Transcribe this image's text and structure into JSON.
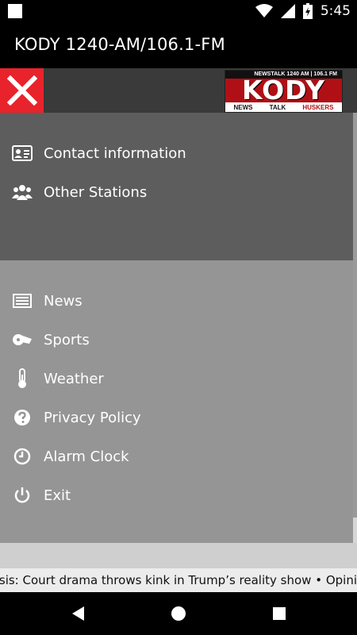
{
  "status_bar": {
    "time": "5:45"
  },
  "app_bar": {
    "title": "KODY 1240-AM/106.1-FM"
  },
  "logo": {
    "top": "NEWSTALK  1240 AM | 106.1 FM",
    "main": "KODY",
    "news": "NEWS",
    "talk": "TALK",
    "huskers": "HUSKERS"
  },
  "drawer": {
    "top_items": [
      {
        "label": "Contact information",
        "icon": "contact-card-icon"
      },
      {
        "label": "Other Stations",
        "icon": "group-icon"
      }
    ],
    "items": [
      {
        "label": "News",
        "icon": "newspaper-icon"
      },
      {
        "label": "Sports",
        "icon": "whistle-icon"
      },
      {
        "label": "Weather",
        "icon": "thermometer-icon"
      },
      {
        "label": "Privacy Policy",
        "icon": "question-icon"
      },
      {
        "label": "Alarm Clock",
        "icon": "clock-icon"
      },
      {
        "label": "Exit",
        "icon": "power-icon"
      }
    ]
  },
  "ticker": {
    "text": "ysis: Court drama throws kink in Trump’s reality show   •   Opinion"
  },
  "colors": {
    "close_bg": "#e8232b",
    "logo_red": "#b01015",
    "top_section": "#5d5d5d",
    "main_section": "#959595"
  }
}
